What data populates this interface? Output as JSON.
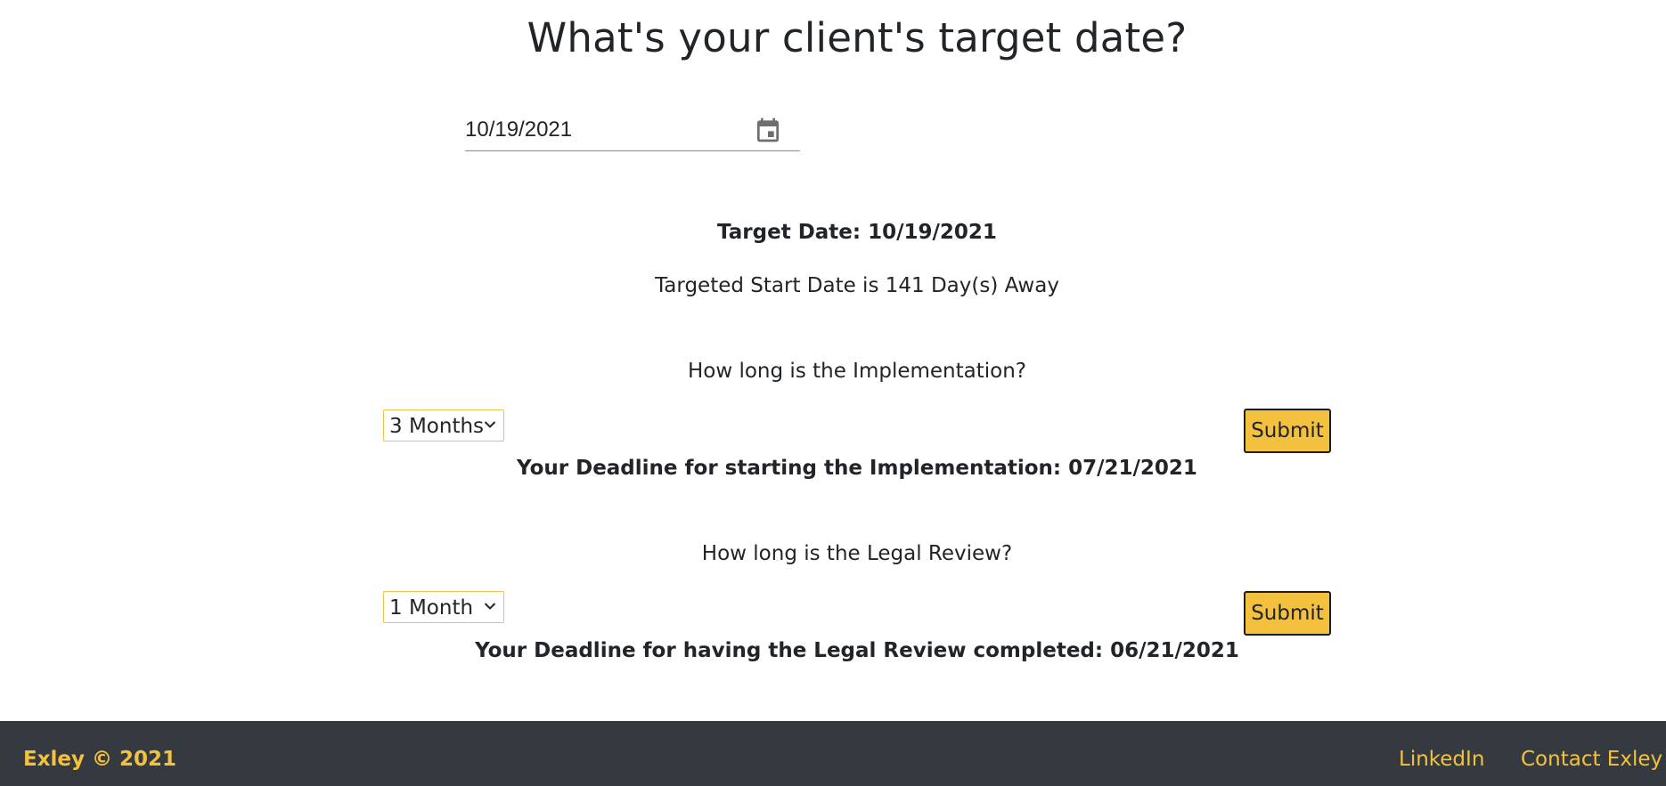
{
  "page": {
    "title": "What's your client's target date?"
  },
  "date_input": {
    "value": "10/19/2021",
    "icon": "calendar-icon"
  },
  "summary": {
    "target_date": "Target Date: 10/19/2021",
    "days_away": "Targeted Start Date is 141 Day(s) Away"
  },
  "implementation": {
    "question": "How long is the Implementation?",
    "selected": "3 Months",
    "submit_label": "Submit",
    "deadline": "Your Deadline for starting the Implementation: 07/21/2021"
  },
  "legal_review": {
    "question": "How long is the Legal Review?",
    "selected": "1 Month",
    "submit_label": "Submit",
    "deadline": "Your Deadline for having the Legal Review completed: 06/21/2021"
  },
  "footer": {
    "brand": "Exley © 2021",
    "links": [
      "LinkedIn",
      "Contact Exley"
    ]
  },
  "colors": {
    "accent": "#f4c13f",
    "footer_bg": "#343a40",
    "text": "#212529"
  }
}
